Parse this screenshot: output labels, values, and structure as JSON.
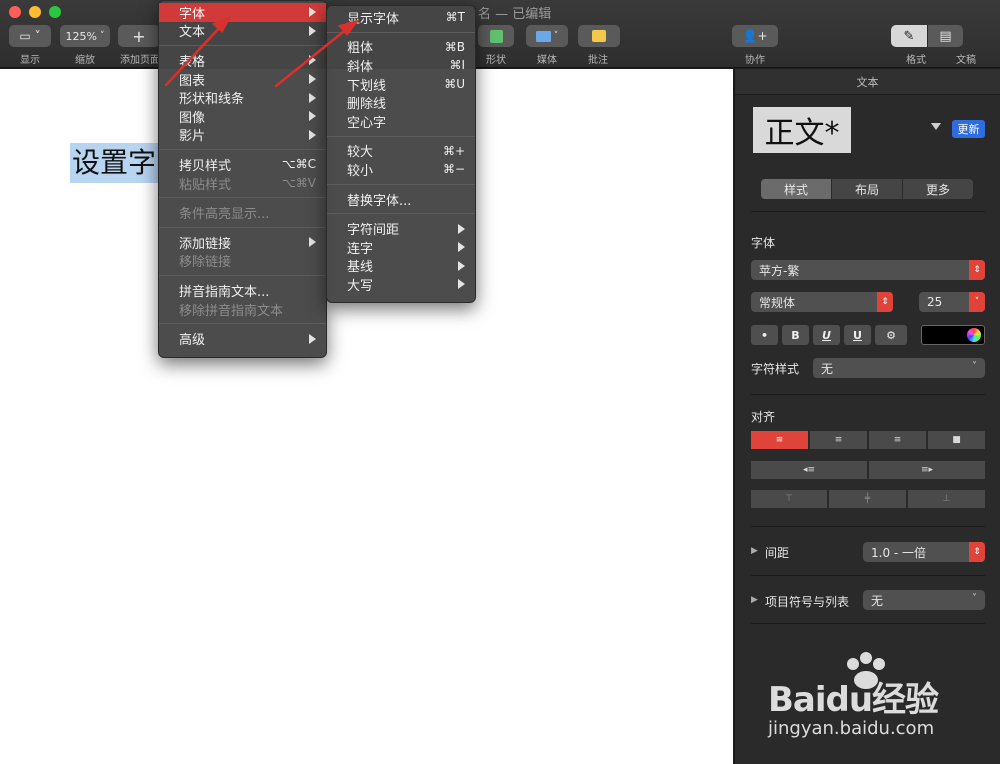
{
  "window": {
    "title": "名 — 已编辑"
  },
  "toolbar": {
    "view_label": "显示",
    "zoom_value": "125%",
    "zoom_label": "缩放",
    "add_page_label": "添加页面",
    "shape_label": "形状",
    "media_label": "媒体",
    "comment_label": "批注",
    "collab_label": "协作",
    "format_label": "格式",
    "document_label": "文稿"
  },
  "canvas": {
    "selected_text": "设置字"
  },
  "inspector": {
    "header": "文本",
    "style_name": "正文*",
    "update_button": "更新",
    "tabs": [
      "样式",
      "布局",
      "更多"
    ],
    "font_section": "字体",
    "font_family": "苹方-繁",
    "font_weight": "常规体",
    "font_size": "25",
    "format_buttons": [
      "•",
      "B",
      "U",
      "U",
      "⚙"
    ],
    "char_style_label": "字符样式",
    "char_style_value": "无",
    "align_section": "对齐",
    "spacing_label": "间距",
    "spacing_value": "1.0 - 一倍",
    "bullets_label": "项目符号与列表",
    "bullets_value": "无"
  },
  "watermark": {
    "brand": "Baidu经验",
    "url": "jingyan.baidu.com"
  },
  "format_menu": {
    "items": [
      {
        "label": "字体",
        "submenu": true,
        "highlighted": true
      },
      {
        "label": "文本",
        "submenu": true
      },
      {
        "sep": true
      },
      {
        "label": "表格",
        "submenu": true
      },
      {
        "label": "图表",
        "submenu": true
      },
      {
        "label": "形状和线条",
        "submenu": true
      },
      {
        "label": "图像",
        "submenu": true
      },
      {
        "label": "影片",
        "submenu": true
      },
      {
        "sep": true
      },
      {
        "label": "拷贝样式",
        "shortcut": "⌥⌘C"
      },
      {
        "label": "粘贴样式",
        "shortcut": "⌥⌘V",
        "disabled": true
      },
      {
        "sep": true
      },
      {
        "label": "条件高亮显示...",
        "disabled": true
      },
      {
        "sep": true
      },
      {
        "label": "添加链接",
        "submenu": true
      },
      {
        "label": "移除链接",
        "disabled": true
      },
      {
        "sep": true
      },
      {
        "label": "拼音指南文本..."
      },
      {
        "label": "移除拼音指南文本",
        "disabled": true
      },
      {
        "sep": true
      },
      {
        "label": "高级",
        "submenu": true
      }
    ]
  },
  "font_menu": {
    "items": [
      {
        "label": "显示字体",
        "shortcut": "⌘T"
      },
      {
        "sep": true
      },
      {
        "label": "粗体",
        "shortcut": "⌘B"
      },
      {
        "label": "斜体",
        "shortcut": "⌘I"
      },
      {
        "label": "下划线",
        "shortcut": "⌘U"
      },
      {
        "label": "删除线"
      },
      {
        "label": "空心字"
      },
      {
        "sep": true
      },
      {
        "label": "较大",
        "shortcut": "⌘+"
      },
      {
        "label": "较小",
        "shortcut": "⌘−"
      },
      {
        "sep": true
      },
      {
        "label": "替换字体..."
      },
      {
        "sep": true
      },
      {
        "label": "字符间距",
        "submenu": true
      },
      {
        "label": "连字",
        "submenu": true
      },
      {
        "label": "基线",
        "submenu": true
      },
      {
        "label": "大写",
        "submenu": true
      }
    ]
  },
  "colors": {
    "highlight": "#d23a3a",
    "update_blue": "#2f6ce0",
    "arrow_red": "#d9302c"
  }
}
